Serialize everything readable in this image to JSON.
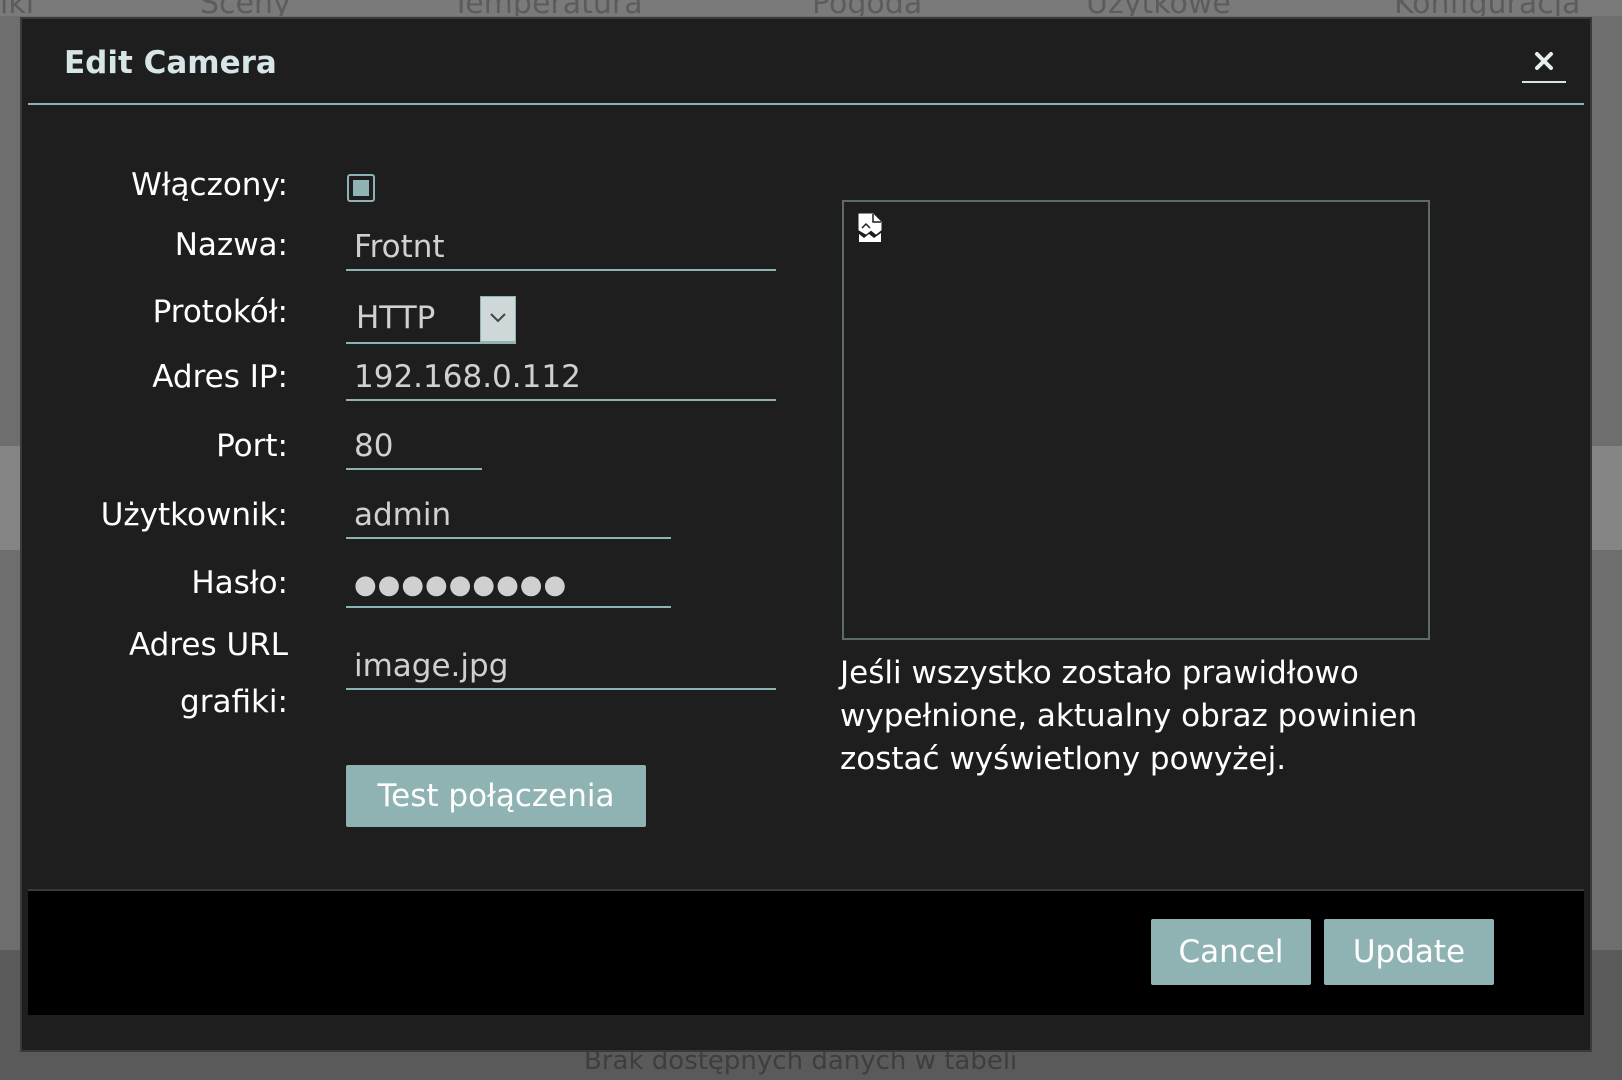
{
  "background": {
    "nav_items": [
      "iki",
      "Sceny",
      "Temperatura",
      "Pogoda",
      "Użytkowe",
      "Konfiguracja"
    ],
    "empty_table_text": "Brak dostępnych danych w tabeli"
  },
  "dialog": {
    "title": "Edit Camera",
    "close_label": "✖",
    "form": {
      "enabled_label": "Włączony:",
      "enabled_checked": true,
      "name_label": "Nazwa:",
      "name_value": "Frotnt",
      "protocol_label": "Protokół:",
      "protocol_value": "HTTP",
      "ip_label": "Adres IP:",
      "ip_value": "192.168.0.112",
      "port_label": "Port:",
      "port_value": "80",
      "user_label": "Użytkownik:",
      "user_value": "admin",
      "password_label": "Hasło:",
      "password_value": "●●●●●●●●●",
      "image_url_label_line1": "Adres URL",
      "image_url_label_line2": "grafiki:",
      "image_url_value": "image.jpg",
      "test_button": "Test połączenia"
    },
    "preview_hint": "Jeśli wszystko zostało prawidłowo wypełnione, aktualny obraz powinien zostać wyświetlony powyżej.",
    "footer": {
      "cancel_button": "Cancel",
      "update_button": "Update"
    }
  },
  "colors": {
    "accent": "#8fb3b3",
    "dialog_bg": "#1e1e1e",
    "footer_bg": "#000000"
  },
  "icons": {
    "close": "close-icon",
    "dropdown": "chevron-down-icon",
    "broken_image": "broken-image-icon"
  }
}
